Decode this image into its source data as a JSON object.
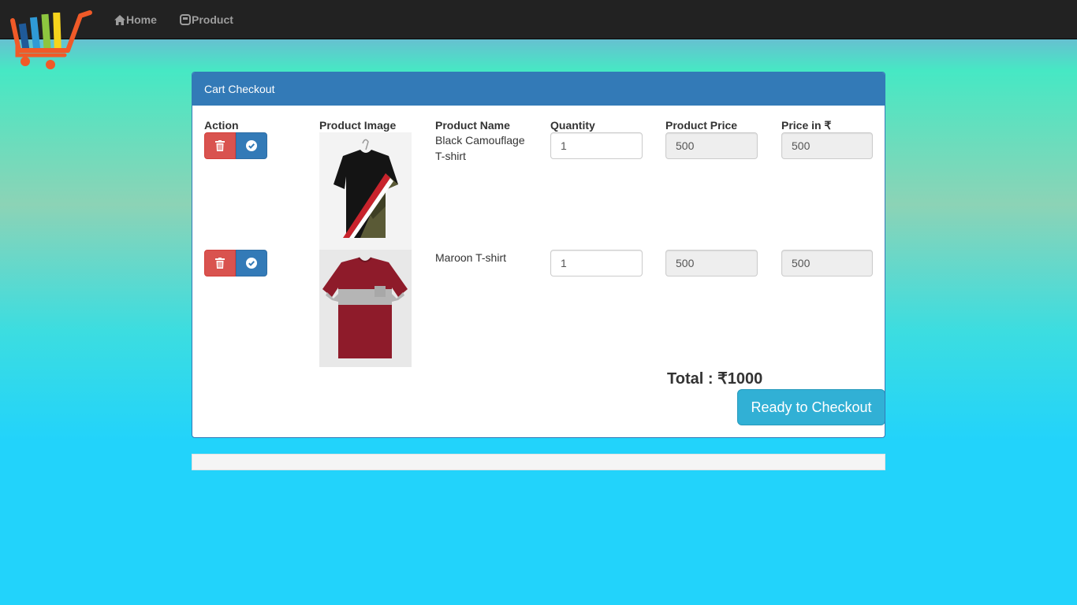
{
  "nav": {
    "home_label": "Home",
    "product_label": "Product"
  },
  "panel": {
    "title": "Cart Checkout",
    "columns": [
      "Action",
      "Product Image",
      "Product Name",
      "Quantity",
      "Product Price",
      "Price in ₹"
    ]
  },
  "items": [
    {
      "name": "Black Camouflage T-shirt",
      "quantity": "1",
      "product_price": "500",
      "price": "500"
    },
    {
      "name": "Maroon T-shirt",
      "quantity": "1",
      "product_price": "500",
      "price": "500"
    }
  ],
  "total_label": "Total : ₹1000",
  "checkout_label": "Ready to Checkout",
  "colors": {
    "navbar": "#222222",
    "primary": "#337ab7",
    "danger": "#d9534f",
    "info": "#31b0d5",
    "background_bottom": "#22d3fb"
  }
}
